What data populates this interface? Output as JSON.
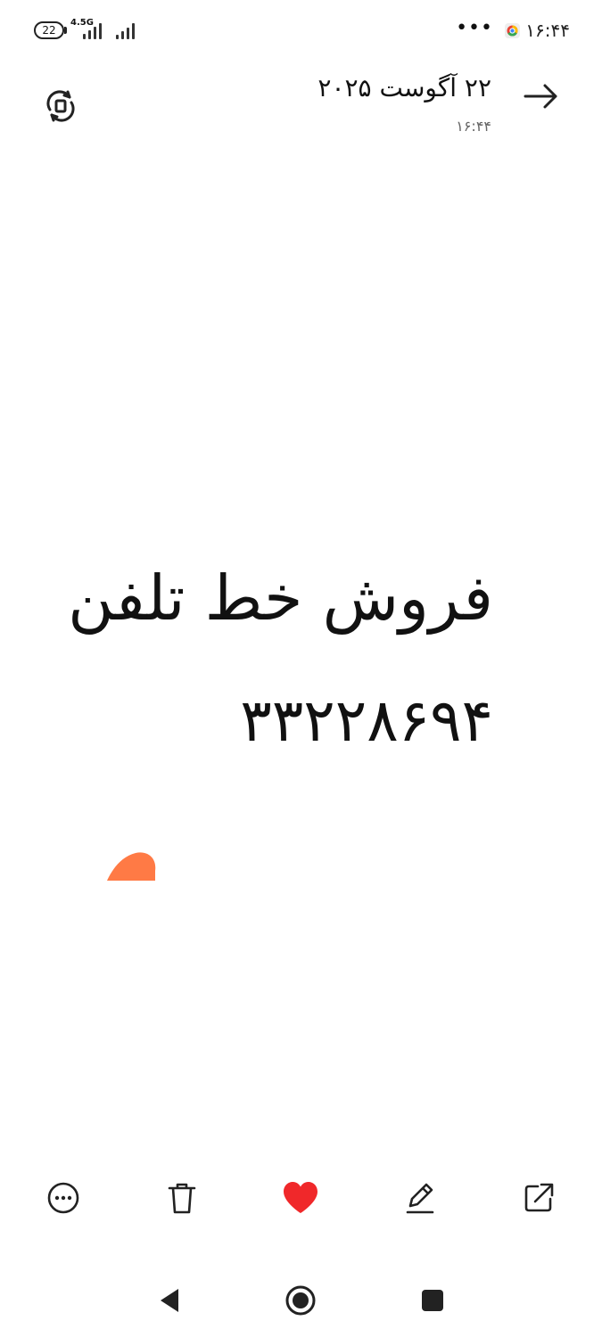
{
  "status_bar": {
    "battery": "22",
    "network": "4.5G",
    "overflow": "•••",
    "time": "۱۶:۴۴"
  },
  "header": {
    "title": "۲۲ آگوست ۲۰۲۵",
    "subtitle": "۱۶:۴۴"
  },
  "photo": {
    "line1": "فروش خط تلفن",
    "line2": "۳۳۲۲۸۶۹۴",
    "blob_color": "#ff7a45"
  },
  "colors": {
    "favorite": "#f0282a"
  },
  "icons": {
    "back": "arrow-right-icon",
    "rotate": "rotate-icon",
    "more": "more-icon",
    "delete": "trash-icon",
    "favorite": "heart-icon",
    "edit": "pencil-icon",
    "share": "share-icon"
  }
}
